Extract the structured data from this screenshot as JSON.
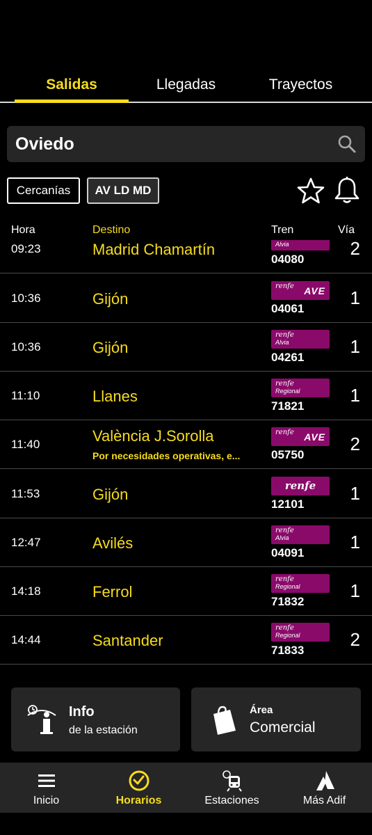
{
  "tabs": [
    {
      "label": "Salidas",
      "active": true
    },
    {
      "label": "Llegadas",
      "active": false
    },
    {
      "label": "Trayectos",
      "active": false
    }
  ],
  "search": {
    "value": "Oviedo",
    "icon": "search-icon"
  },
  "filters": [
    {
      "label": "Cercanías",
      "active": false
    },
    {
      "label": "AV LD MD",
      "active": true
    }
  ],
  "columns": {
    "hora": "Hora",
    "destino": "Destino",
    "tren": "Tren",
    "via": "Vía"
  },
  "departures": [
    {
      "time": "09:23",
      "destination": "Madrid Chamartín",
      "note": "",
      "brand": "renfe",
      "service": "Alvia",
      "train": "04080",
      "track": "2"
    },
    {
      "time": "10:36",
      "destination": "Gijón",
      "note": "",
      "brand": "renfe",
      "service": "AVE",
      "train": "04061",
      "track": "1"
    },
    {
      "time": "10:36",
      "destination": "Gijón",
      "note": "",
      "brand": "renfe",
      "service": "Alvia",
      "train": "04261",
      "track": "1"
    },
    {
      "time": "11:10",
      "destination": "Llanes",
      "note": "",
      "brand": "renfe",
      "service": "Regional",
      "train": "71821",
      "track": "1"
    },
    {
      "time": "11:40",
      "destination": "València J.Sorolla",
      "note": "Por necesidades operativas, e...",
      "brand": "renfe",
      "service": "AVE",
      "train": "05750",
      "track": "2"
    },
    {
      "time": "11:53",
      "destination": "Gijón",
      "note": "",
      "brand": "renfe",
      "service": "",
      "train": "12101",
      "track": "1"
    },
    {
      "time": "12:47",
      "destination": "Avilés",
      "note": "",
      "brand": "renfe",
      "service": "Alvia",
      "train": "04091",
      "track": "1"
    },
    {
      "time": "14:18",
      "destination": "Ferrol",
      "note": "",
      "brand": "renfe",
      "service": "Regional",
      "train": "71832",
      "track": "1"
    },
    {
      "time": "14:44",
      "destination": "Santander",
      "note": "",
      "brand": "renfe",
      "service": "Regional",
      "train": "71833",
      "track": "2"
    }
  ],
  "cards": {
    "info": {
      "title": "Info",
      "subtitle": "de la estación",
      "icon": "info-station-icon"
    },
    "area": {
      "title": "Área",
      "subtitle": "Comercial",
      "icon": "shopping-bag-icon"
    }
  },
  "nav": [
    {
      "label": "Inicio",
      "icon": "menu-icon",
      "active": false
    },
    {
      "label": "Horarios",
      "icon": "clock-icon",
      "active": true
    },
    {
      "label": "Estaciones",
      "icon": "station-train-icon",
      "active": false
    },
    {
      "label": "Más Adif",
      "icon": "adif-logo-icon",
      "active": false
    }
  ],
  "colors": {
    "accent": "#f6dc1e",
    "background": "#000000",
    "panel": "#262626",
    "renfe": "#8a0a6a"
  }
}
